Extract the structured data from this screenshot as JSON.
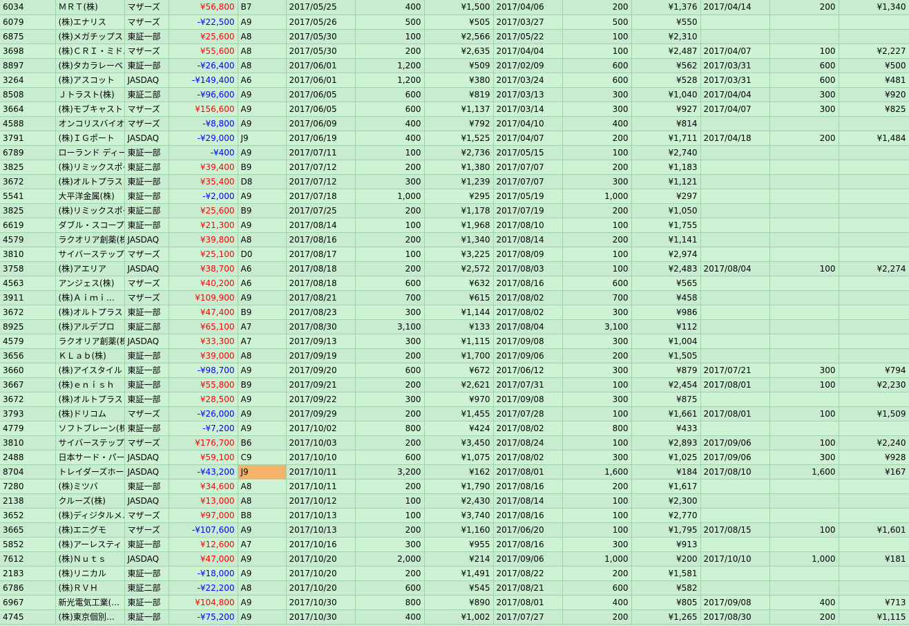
{
  "rows": [
    [
      "6034",
      "ＭＲＴ(株)",
      "マザーズ",
      "¥56,800",
      "B7",
      "2017/05/25",
      "400",
      "¥1,500",
      "2017/04/06",
      "200",
      "¥1,376",
      "2017/04/14",
      "200",
      "¥1,340"
    ],
    [
      "6079",
      "(株)エナリス",
      "マザーズ",
      "-¥22,500",
      "A9",
      "2017/05/26",
      "500",
      "¥505",
      "2017/03/27",
      "500",
      "¥550",
      "",
      "",
      ""
    ],
    [
      "6875",
      "(株)メガチップス",
      "東証一部",
      "¥25,600",
      "A8",
      "2017/05/30",
      "100",
      "¥2,566",
      "2017/05/22",
      "100",
      "¥2,310",
      "",
      "",
      ""
    ],
    [
      "3698",
      "(株)ＣＲＩ・ミド…",
      "マザーズ",
      "¥55,600",
      "A8",
      "2017/05/30",
      "200",
      "¥2,635",
      "2017/04/04",
      "100",
      "¥2,487",
      "2017/04/07",
      "100",
      "¥2,227"
    ],
    [
      "8897",
      "(株)タカラレーベン",
      "東証一部",
      "-¥26,400",
      "A8",
      "2017/06/01",
      "1,200",
      "¥509",
      "2017/02/09",
      "600",
      "¥562",
      "2017/03/31",
      "600",
      "¥500"
    ],
    [
      "3264",
      "(株)アスコット",
      "JASDAQ",
      "-¥149,400",
      "A6",
      "2017/06/01",
      "1,200",
      "¥380",
      "2017/03/24",
      "600",
      "¥528",
      "2017/03/31",
      "600",
      "¥481"
    ],
    [
      "8508",
      "Ｊトラスト(株)",
      "東証二部",
      "-¥96,600",
      "A9",
      "2017/06/05",
      "600",
      "¥819",
      "2017/03/13",
      "300",
      "¥1,040",
      "2017/04/04",
      "300",
      "¥920"
    ],
    [
      "3664",
      "(株)モブキャスト",
      "マザーズ",
      "¥156,600",
      "A9",
      "2017/06/05",
      "600",
      "¥1,137",
      "2017/03/14",
      "300",
      "¥927",
      "2017/04/07",
      "300",
      "¥825"
    ],
    [
      "4588",
      "オンコリスバイオフ…",
      "マザーズ",
      "-¥8,800",
      "A9",
      "2017/06/09",
      "400",
      "¥792",
      "2017/04/10",
      "400",
      "¥814",
      "",
      "",
      ""
    ],
    [
      "3791",
      "(株)ＩＧポート",
      "JASDAQ",
      "-¥29,000",
      "J9",
      "2017/06/19",
      "400",
      "¥1,525",
      "2017/04/07",
      "200",
      "¥1,711",
      "2017/04/18",
      "200",
      "¥1,484"
    ],
    [
      "6789",
      "ローランド ディー…",
      "東証一部",
      "-¥400",
      "A9",
      "2017/07/11",
      "100",
      "¥2,736",
      "2017/05/15",
      "100",
      "¥2,740",
      "",
      "",
      ""
    ],
    [
      "3825",
      "(株)リミックスポイ…",
      "東証二部",
      "¥39,400",
      "B9",
      "2017/07/12",
      "200",
      "¥1,380",
      "2017/07/07",
      "200",
      "¥1,183",
      "",
      "",
      ""
    ],
    [
      "3672",
      "(株)オルトプラス",
      "東証一部",
      "¥35,400",
      "D8",
      "2017/07/12",
      "300",
      "¥1,239",
      "2017/07/07",
      "300",
      "¥1,121",
      "",
      "",
      ""
    ],
    [
      "5541",
      "大平洋金属(株)",
      "東証一部",
      "-¥2,000",
      "A9",
      "2017/07/18",
      "1,000",
      "¥295",
      "2017/05/19",
      "1,000",
      "¥297",
      "",
      "",
      ""
    ],
    [
      "3825",
      "(株)リミックスポイ…",
      "東証二部",
      "¥25,600",
      "B9",
      "2017/07/25",
      "200",
      "¥1,178",
      "2017/07/19",
      "200",
      "¥1,050",
      "",
      "",
      ""
    ],
    [
      "6619",
      "ダブル・スコープ(株)",
      "東証一部",
      "¥21,300",
      "A9",
      "2017/08/14",
      "100",
      "¥1,968",
      "2017/08/10",
      "100",
      "¥1,755",
      "",
      "",
      ""
    ],
    [
      "4579",
      "ラクオリア創薬(株)",
      "JASDAQ",
      "¥39,800",
      "A8",
      "2017/08/16",
      "200",
      "¥1,340",
      "2017/08/14",
      "200",
      "¥1,141",
      "",
      "",
      ""
    ],
    [
      "3810",
      "サイバーステップ(…",
      "マザーズ",
      "¥25,100",
      "D0",
      "2017/08/17",
      "100",
      "¥3,225",
      "2017/08/09",
      "100",
      "¥2,974",
      "",
      "",
      ""
    ],
    [
      "3758",
      "(株)アエリア",
      "JASDAQ",
      "¥38,700",
      "A6",
      "2017/08/18",
      "200",
      "¥2,572",
      "2017/08/03",
      "100",
      "¥2,483",
      "2017/08/04",
      "100",
      "¥2,274"
    ],
    [
      "4563",
      "アンジェス(株)",
      "マザーズ",
      "¥40,200",
      "A6",
      "2017/08/18",
      "600",
      "¥632",
      "2017/08/16",
      "600",
      "¥565",
      "",
      "",
      ""
    ],
    [
      "3911",
      "(株)Ａｉｍｉ…",
      "マザーズ",
      "¥109,900",
      "A9",
      "2017/08/21",
      "700",
      "¥615",
      "2017/08/02",
      "700",
      "¥458",
      "",
      "",
      ""
    ],
    [
      "3672",
      "(株)オルトプラス",
      "東証一部",
      "¥47,400",
      "B9",
      "2017/08/23",
      "300",
      "¥1,144",
      "2017/08/02",
      "300",
      "¥986",
      "",
      "",
      ""
    ],
    [
      "8925",
      "(株)アルデプロ",
      "東証二部",
      "¥65,100",
      "A7",
      "2017/08/30",
      "3,100",
      "¥133",
      "2017/08/04",
      "3,100",
      "¥112",
      "",
      "",
      ""
    ],
    [
      "4579",
      "ラクオリア創薬(株)",
      "JASDAQ",
      "¥33,300",
      "A7",
      "2017/09/13",
      "300",
      "¥1,115",
      "2017/09/08",
      "300",
      "¥1,004",
      "",
      "",
      ""
    ],
    [
      "3656",
      "ＫＬａｂ(株)",
      "東証一部",
      "¥39,000",
      "A8",
      "2017/09/19",
      "200",
      "¥1,700",
      "2017/09/06",
      "200",
      "¥1,505",
      "",
      "",
      ""
    ],
    [
      "3660",
      "(株)アイスタイル",
      "東証一部",
      "-¥98,700",
      "A9",
      "2017/09/20",
      "600",
      "¥672",
      "2017/06/12",
      "300",
      "¥879",
      "2017/07/21",
      "300",
      "¥794"
    ],
    [
      "3667",
      "(株)ｅｎｉｓｈ",
      "東証一部",
      "¥55,800",
      "B9",
      "2017/09/21",
      "200",
      "¥2,621",
      "2017/07/31",
      "100",
      "¥2,454",
      "2017/08/01",
      "100",
      "¥2,230"
    ],
    [
      "3672",
      "(株)オルトプラス",
      "東証一部",
      "¥28,500",
      "A9",
      "2017/09/22",
      "300",
      "¥970",
      "2017/09/08",
      "300",
      "¥875",
      "",
      "",
      ""
    ],
    [
      "3793",
      "(株)ドリコム",
      "マザーズ",
      "-¥26,000",
      "A9",
      "2017/09/29",
      "200",
      "¥1,455",
      "2017/07/28",
      "100",
      "¥1,661",
      "2017/08/01",
      "100",
      "¥1,509"
    ],
    [
      "4779",
      "ソフトブレーン(株)",
      "東証一部",
      "-¥7,200",
      "A9",
      "2017/10/02",
      "800",
      "¥424",
      "2017/08/02",
      "800",
      "¥433",
      "",
      "",
      ""
    ],
    [
      "3810",
      "サイバーステップ(…",
      "マザーズ",
      "¥176,700",
      "B6",
      "2017/10/03",
      "200",
      "¥3,450",
      "2017/08/24",
      "100",
      "¥2,893",
      "2017/09/06",
      "100",
      "¥2,240"
    ],
    [
      "2488",
      "日本サード・パー…",
      "JASDAQ",
      "¥59,100",
      "C9",
      "2017/10/10",
      "600",
      "¥1,075",
      "2017/08/02",
      "300",
      "¥1,025",
      "2017/09/06",
      "300",
      "¥928"
    ],
    [
      "8704",
      "トレイダーズホー…",
      "JASDAQ",
      "-¥43,200",
      "J9",
      "2017/10/11",
      "3,200",
      "¥162",
      "2017/08/01",
      "1,600",
      "¥184",
      "2017/08/10",
      "1,600",
      "¥167"
    ],
    [
      "7280",
      "(株)ミツバ",
      "東証一部",
      "¥34,600",
      "A8",
      "2017/10/11",
      "200",
      "¥1,790",
      "2017/08/16",
      "200",
      "¥1,617",
      "",
      "",
      ""
    ],
    [
      "2138",
      "クルーズ(株)",
      "JASDAQ",
      "¥13,000",
      "A8",
      "2017/10/12",
      "100",
      "¥2,430",
      "2017/08/14",
      "100",
      "¥2,300",
      "",
      "",
      ""
    ],
    [
      "3652",
      "(株)ディジタルメ…",
      "マザーズ",
      "¥97,000",
      "B8",
      "2017/10/13",
      "100",
      "¥3,740",
      "2017/08/16",
      "100",
      "¥2,770",
      "",
      "",
      ""
    ],
    [
      "3665",
      "(株)エニグモ",
      "マザーズ",
      "-¥107,600",
      "A9",
      "2017/10/13",
      "200",
      "¥1,160",
      "2017/06/20",
      "100",
      "¥1,795",
      "2017/08/15",
      "100",
      "¥1,601"
    ],
    [
      "5852",
      "(株)アーレスティ",
      "東証一部",
      "¥12,600",
      "A7",
      "2017/10/16",
      "300",
      "¥955",
      "2017/08/16",
      "300",
      "¥913",
      "",
      "",
      ""
    ],
    [
      "7612",
      "(株)Ｎｕｔｓ",
      "JASDAQ",
      "¥47,000",
      "A9",
      "2017/10/20",
      "2,000",
      "¥214",
      "2017/09/06",
      "1,000",
      "¥200",
      "2017/10/10",
      "1,000",
      "¥181"
    ],
    [
      "2183",
      "(株)リニカル",
      "東証一部",
      "-¥18,000",
      "A9",
      "2017/10/20",
      "200",
      "¥1,491",
      "2017/08/22",
      "200",
      "¥1,581",
      "",
      "",
      ""
    ],
    [
      "6786",
      "(株)ＲＶＨ",
      "東証二部",
      "-¥22,200",
      "A8",
      "2017/10/20",
      "600",
      "¥545",
      "2017/08/21",
      "600",
      "¥582",
      "",
      "",
      ""
    ],
    [
      "6967",
      "新光電気工業(…",
      "東証一部",
      "¥104,800",
      "A9",
      "2017/10/30",
      "800",
      "¥890",
      "2017/08/01",
      "400",
      "¥805",
      "2017/09/08",
      "400",
      "¥713"
    ],
    [
      "4745",
      "(株)東京個別…",
      "東証一部",
      "-¥75,200",
      "A9",
      "2017/10/30",
      "400",
      "¥1,002",
      "2017/07/27",
      "200",
      "¥1,265",
      "2017/08/30",
      "200",
      "¥1,115"
    ]
  ],
  "highlight": {
    "row": 32,
    "col": 4,
    "color": "#f4b36b"
  },
  "colors": {
    "positive": "#ff0000",
    "negative": "#0000ff",
    "grid": "#9fd3a9",
    "bg": "#c6efce"
  }
}
